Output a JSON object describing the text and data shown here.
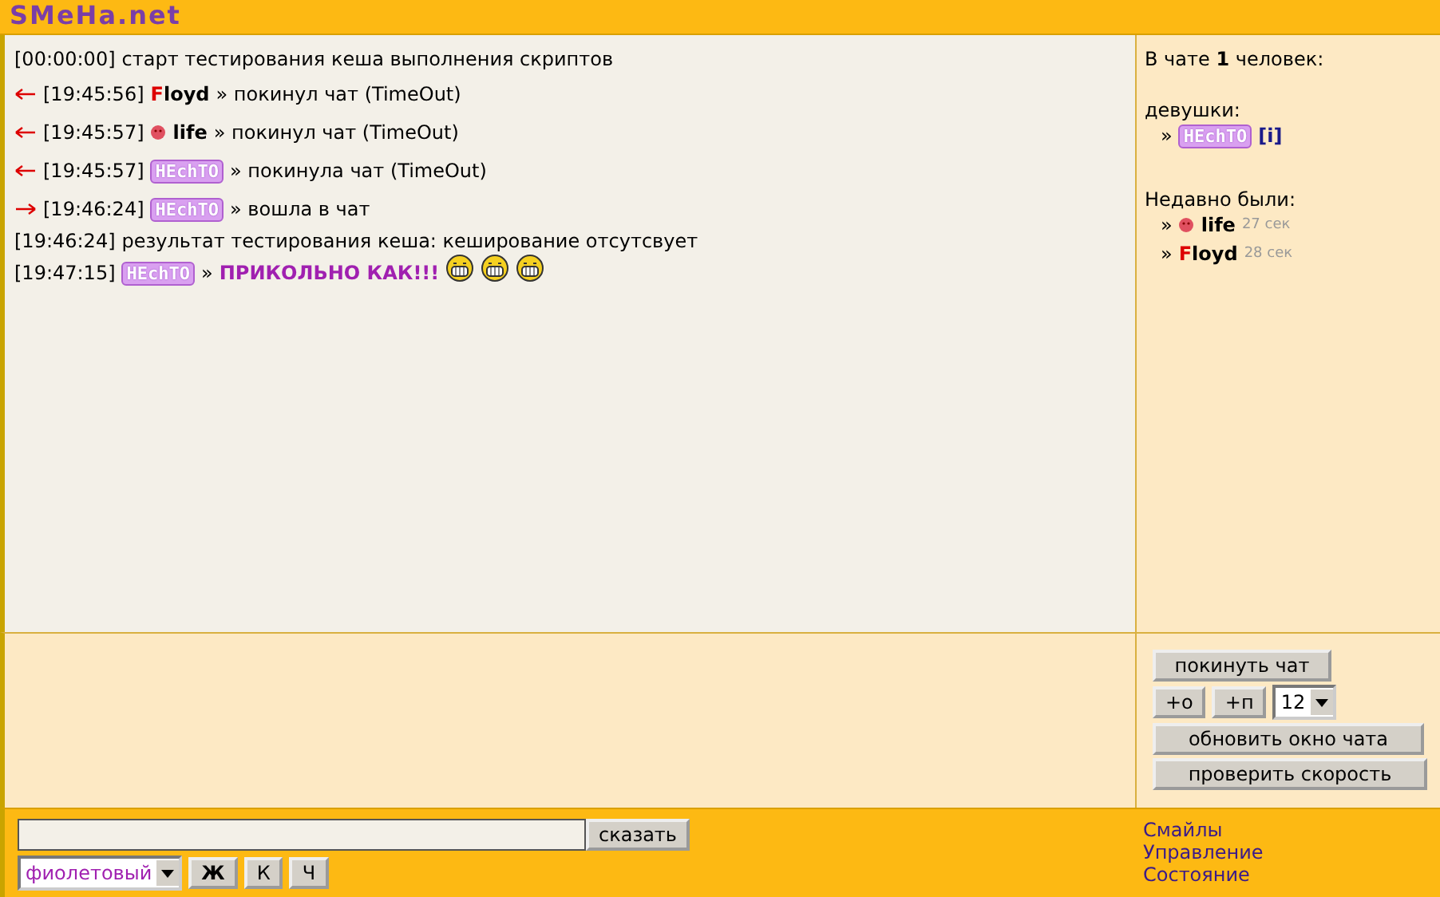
{
  "header": {
    "logo": "SMeHa.net"
  },
  "messages": [
    {
      "kind": "system",
      "time": "[00:00:00]",
      "text": "старт тестирования кеша выполнения скриптов"
    },
    {
      "kind": "leave",
      "time": "[19:45:56]",
      "nick": {
        "name": "Floyd",
        "kind": "initial"
      },
      "text": "» покинул чат (TimeOut)"
    },
    {
      "kind": "leave",
      "time": "[19:45:57]",
      "nick": {
        "name": "life",
        "kind": "dot"
      },
      "text": "» покинул чат (TimeOut)"
    },
    {
      "kind": "leave",
      "time": "[19:45:57]",
      "nick": {
        "name": "HEchTO",
        "kind": "graphic"
      },
      "text": "» покинула чат (TimeOut)"
    },
    {
      "kind": "enter",
      "time": "[19:46:24]",
      "nick": {
        "name": "HEchTO",
        "kind": "graphic"
      },
      "text": "» вошла в чат"
    },
    {
      "kind": "system",
      "time": "[19:46:24]",
      "text": "результат тестирования кеша: кеширование отсутсвует"
    },
    {
      "kind": "say",
      "time": "[19:47:15]",
      "nick": {
        "name": "HEchTO",
        "kind": "graphic"
      },
      "sep": "»",
      "text": "ПРИКОЛЬНО КАК!!!",
      "emoticons": [
        {
          "kind": "grin"
        },
        {
          "kind": "grin"
        },
        {
          "kind": "grin"
        }
      ]
    }
  ],
  "sidebar": {
    "count_pre": "В чате",
    "count": "1",
    "count_post": "человек:",
    "group": "девушки:",
    "online": [
      {
        "bullet": "»",
        "nick": {
          "name": "HEchTO",
          "kind": "graphic"
        },
        "info": "[i]"
      }
    ],
    "recent_title": "Недавно были:",
    "recent": [
      {
        "bullet": "»",
        "nick": {
          "name": "life",
          "kind": "dot"
        },
        "ago": "27 сек"
      },
      {
        "bullet": "»",
        "nick": {
          "name": "Floyd",
          "kind": "initial"
        },
        "ago": "28 сек"
      }
    ]
  },
  "controls": {
    "leave": "покинуть чат",
    "plus_o": "+о",
    "plus_p": "+п",
    "font_size": "12",
    "refresh": "обновить окно чата",
    "speed": "проверить скорость"
  },
  "input": {
    "send": "сказать",
    "color_choice": "фиолетовый",
    "bold": "Ж",
    "italic": "К",
    "underline": "Ч"
  },
  "links": [
    "Смайлы",
    "Управление",
    "Состояние"
  ]
}
